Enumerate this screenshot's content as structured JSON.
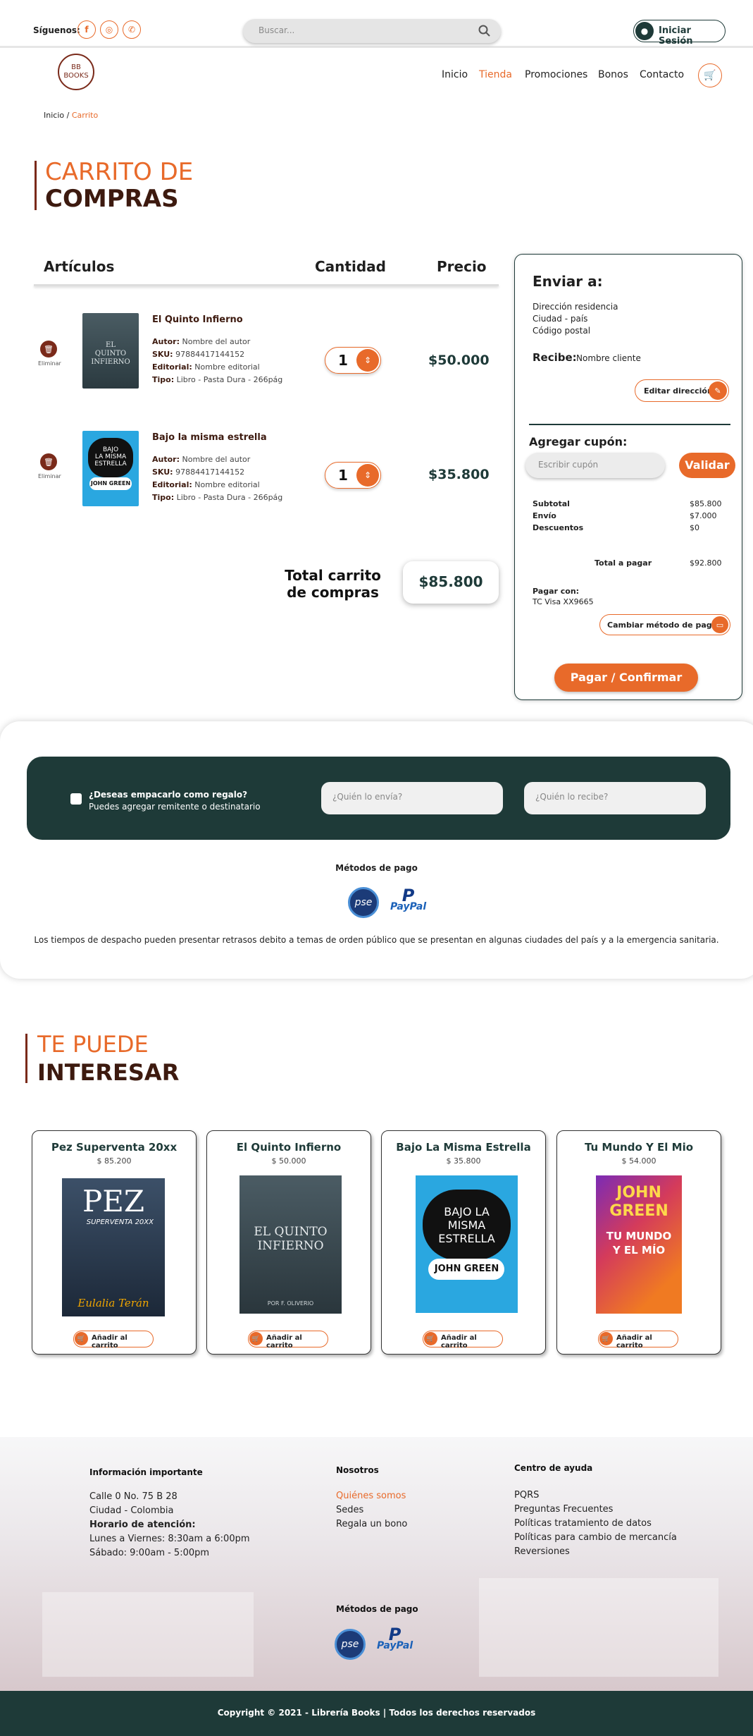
{
  "topbar": {
    "follow_label": "Síguenos:",
    "social": [
      "f",
      "◎",
      "✆"
    ],
    "search_placeholder": "Buscar...",
    "login_label": "Iniciar Sesión"
  },
  "logo": {
    "line1": "BB",
    "line2": "BOOKS"
  },
  "nav": {
    "items": [
      "Inicio",
      "Tienda",
      "Promociones",
      "Bonos",
      "Contacto"
    ],
    "active": "Tienda"
  },
  "breadcrumb": {
    "home": "Inicio",
    "sep": "/",
    "current": "Carrito"
  },
  "cart_title": {
    "line1": "CARRITO DE",
    "line2": "COMPRAS"
  },
  "table": {
    "col_items": "Artículos",
    "col_qty": "Cantidad",
    "col_price": "Precio"
  },
  "items": [
    {
      "title": "El Quinto Infierno",
      "author_label": "Autor:",
      "author": "Nombre del autor",
      "sku_label": "SKU:",
      "sku": "97884417144152",
      "publisher_label": "Editorial:",
      "publisher": "Nombre editorial",
      "type_label": "Tipo:",
      "type": "Libro - Pasta Dura - 266pág",
      "qty": "1",
      "price": "$50.000",
      "remove_label": "Eliminar"
    },
    {
      "title": "Bajo la misma estrella",
      "author_label": "Autor:",
      "author": "Nombre del autor",
      "sku_label": "SKU:",
      "sku": "97884417144152",
      "publisher_label": "Editorial:",
      "publisher": "Nombre editorial",
      "type_label": "Tipo:",
      "type": "Libro - Pasta Dura - 266pág",
      "qty": "1",
      "price": "$35.800",
      "remove_label": "Eliminar"
    }
  ],
  "total": {
    "label_line1": "Total carrito",
    "label_line2": "de compras",
    "value": "$85.800"
  },
  "shipping": {
    "title": "Enviar a:",
    "address": [
      "Dirección residencia",
      "Ciudad - país",
      "Código postal"
    ],
    "receiver_label": "Recibe:",
    "receiver": "Nombre cliente",
    "edit_label": "Editar dirección"
  },
  "coupon": {
    "title": "Agregar cupón:",
    "placeholder": "Escribir cupón",
    "validate_label": "Validar"
  },
  "summary": {
    "subtotal_label": "Subtotal",
    "subtotal": "$85.800",
    "shipping_label": "Envío",
    "shipping": "$7.000",
    "discount_label": "Descuentos",
    "discount": "$0",
    "total_label": "Total a pagar",
    "total": "$92.800",
    "pay_with_label": "Pagar con:",
    "pay_with": "TC Visa XX9665",
    "change_label": "Cambiar método de pago",
    "confirm_label": "Pagar / Confirmar"
  },
  "gift": {
    "question": "¿Deseas empacarlo como regalo?",
    "hint": "Puedes agregar remitente o destinatario",
    "from_placeholder": "¿Quién lo envía?",
    "to_placeholder": "¿Quién lo recibe?"
  },
  "payment_methods": {
    "title": "Métodos de pago",
    "pse": "pse",
    "paypal": "PayPal"
  },
  "notice": "Los tiempos de despacho pueden presentar retrasos debito a temas de orden público que se presentan en algunas ciudades del país y a la emergencia sanitaria.",
  "interest_title": {
    "line1": "TE PUEDE",
    "line2": "INTERESAR"
  },
  "products": [
    {
      "title": "Pez  Superventa 20xx",
      "price": "$ 85.200",
      "add": "Añadir al carrito",
      "cover_title": "PEZ",
      "cover_sub": "SUPERVENTA 20XX",
      "cover_author": "Eulalia Terán",
      "color": "#2a3a4e"
    },
    {
      "title": "El Quinto Infierno",
      "price": "$ 50.000",
      "add": "Añadir al carrito",
      "cover_title": "EL QUINTO INFIERNO",
      "cover_sub": "",
      "cover_author": "POR F. OLIVERIO",
      "color": "#3a4a52"
    },
    {
      "title": "Bajo La Misma Estrella",
      "price": "$ 35.800",
      "add": "Añadir al carrito",
      "cover_title": "BAJO LA MISMA ESTRELLA",
      "cover_sub": "",
      "cover_author": "JOHN GREEN",
      "color": "#2aa7e0"
    },
    {
      "title": "Tu Mundo Y El Mio",
      "price": "$ 54.000",
      "add": "Añadir al carrito",
      "cover_title": "JOHN GREEN",
      "cover_sub": "TU MUNDO Y EL MÍO",
      "cover_author": "",
      "color": "#d43b5b"
    }
  ],
  "footer": {
    "info_title": "Información importante",
    "address": [
      "Calle 0 No. 75 B 28",
      "Ciudad - Colombia"
    ],
    "hours_label": "Horario de atención:",
    "hours": [
      "Lunes a Viernes: 8:30am a 6:00pm",
      "Sábado: 9:00am - 5:00pm"
    ],
    "about_title": "Nosotros",
    "about_links": [
      "Quiénes somos",
      "Sedes",
      "Regala un bono"
    ],
    "help_title": "Centro de ayuda",
    "help_links": [
      "PQRS",
      "Preguntas Frecuentes",
      "Políticas tratamiento de datos",
      "Políticas para cambio de mercancía",
      "Reversiones"
    ],
    "payment_title": "Métodos de pago",
    "copyright": "Copyright © 2021 - Librería Books  | Todos los derechos reservados"
  },
  "colors": {
    "accent": "#e86a2a",
    "brand_dark": "#1e3a38",
    "brown": "#3d1a0f"
  }
}
